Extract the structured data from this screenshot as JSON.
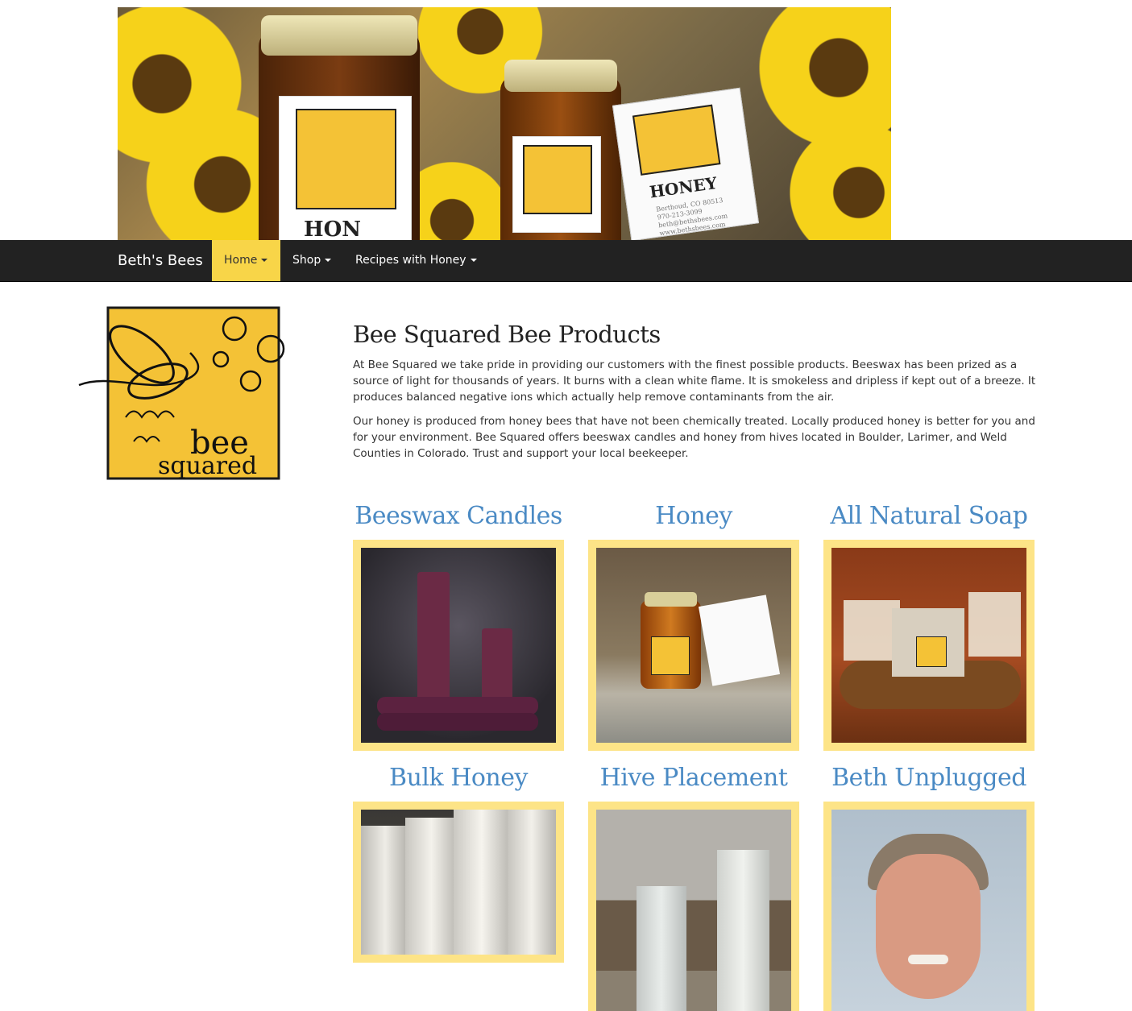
{
  "banner": {
    "alt_icon": "banner-honey-jars-sunflowers",
    "label_text": "HONEY",
    "address_lines": [
      "Berthoud, CO 80513",
      "970-213-3099",
      "beth@bethsbees.com",
      "www.bethsbees.com"
    ]
  },
  "navbar": {
    "brand": "Beth's Bees",
    "items": [
      {
        "label": "Home",
        "active": true
      },
      {
        "label": "Shop",
        "active": false
      },
      {
        "label": "Recipes with Honey",
        "active": false
      }
    ]
  },
  "logo": {
    "line1": "bee",
    "line2": "squared"
  },
  "main": {
    "title": "Bee Squared Bee Products",
    "paragraphs": [
      "At Bee Squared we take pride in providing our customers with the finest possible products. Beeswax has been prized as a source of light for thousands of years. It burns with a clean white flame. It is smokeless and dripless if kept out of a breeze. It produces balanced negative ions which actually help remove contaminants from the air.",
      "Our honey is produced from honey bees that have not been chemically treated. Locally produced honey is better for you and for your environment. Bee Squared offers beeswax candles and honey from hives located in Boulder, Larimer, and Weld Counties in Colorado. Trust and support your local beekeeper."
    ]
  },
  "products": [
    {
      "title": "Beeswax Candles",
      "image": "beeswax-candles-photo"
    },
    {
      "title": "Honey",
      "image": "honey-jar-photo"
    },
    {
      "title": "All Natural Soap",
      "image": "soap-photo"
    },
    {
      "title": "Bulk Honey",
      "image": "bulk-honey-buckets-photo"
    },
    {
      "title": "Hive Placement",
      "image": "beehives-photo"
    },
    {
      "title": "Beth Unplugged",
      "image": "beth-portrait-photo"
    }
  ],
  "colors": {
    "accent_yellow": "#f8d548",
    "frame_yellow": "#fde487",
    "link_blue": "#4a8ac4",
    "navbar_bg": "#222222"
  }
}
